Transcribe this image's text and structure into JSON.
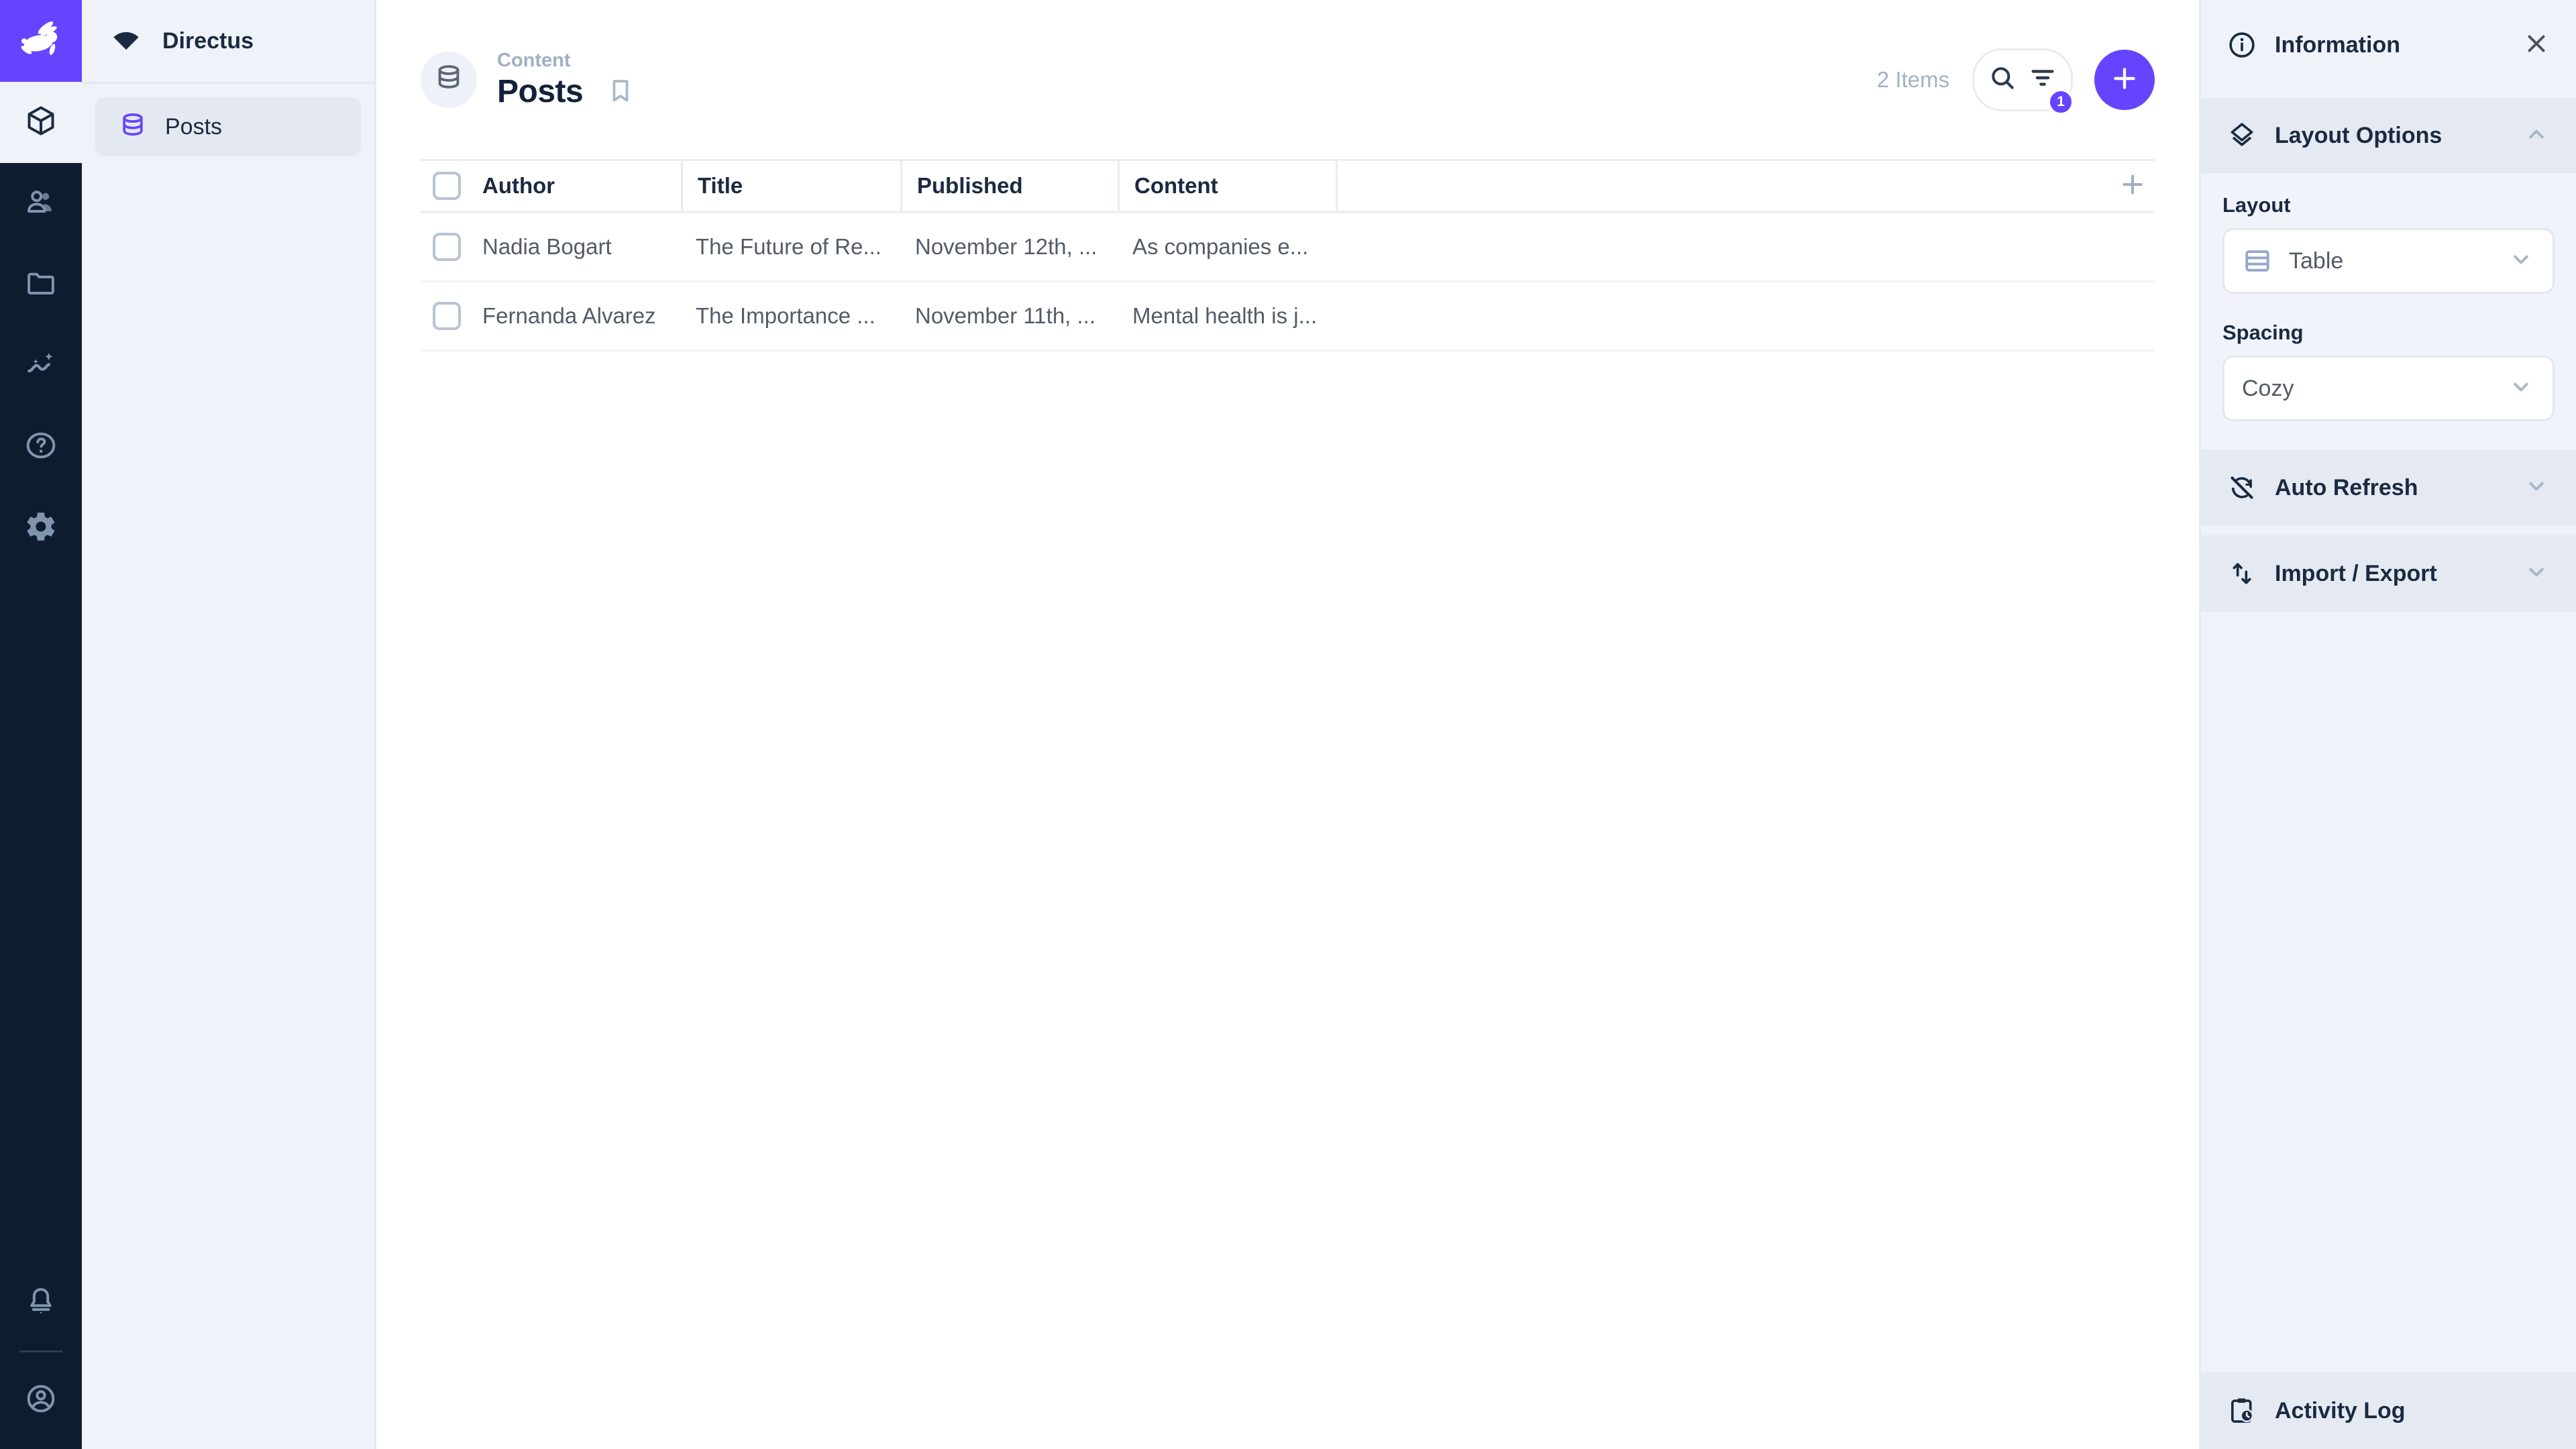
{
  "colors": {
    "accent_purple": "#6644ff",
    "module_bar_bg": "#0e1c30",
    "sidebar_bg": "#eff3f9",
    "band_bg": "#e5eaf2",
    "text_dark": "#1b2a41",
    "text_gray": "#535b69",
    "text_subdued": "#a3b1c5"
  },
  "icons": {
    "logo": "directus-rabbit",
    "modules": [
      "content-cube",
      "users",
      "files-folder",
      "insights-chart",
      "help-question",
      "settings-gear"
    ],
    "bottom": [
      "notifications-bell",
      "account-circle"
    ]
  },
  "sidebar": {
    "project_name": "Directus",
    "items": [
      {
        "label": "Posts",
        "active": true
      }
    ]
  },
  "header": {
    "breadcrumb": "Content",
    "title": "Posts",
    "items_count": "2 Items",
    "filter_badge": "1"
  },
  "table": {
    "columns": [
      "Author",
      "Title",
      "Published",
      "Content"
    ],
    "rows": [
      {
        "author": "Nadia Bogart",
        "title": "The Future of Re...",
        "published": "November 12th, ...",
        "content": "As companies e..."
      },
      {
        "author": "Fernanda Alvarez",
        "title": "The Importance ...",
        "published": "November 11th, ...",
        "content": "Mental health is j..."
      }
    ]
  },
  "panel": {
    "information": "Information",
    "layout_options": "Layout Options",
    "layout_label": "Layout",
    "layout_value": "Table",
    "spacing_label": "Spacing",
    "spacing_value": "Cozy",
    "auto_refresh": "Auto Refresh",
    "import_export": "Import / Export",
    "activity_log": "Activity Log"
  }
}
